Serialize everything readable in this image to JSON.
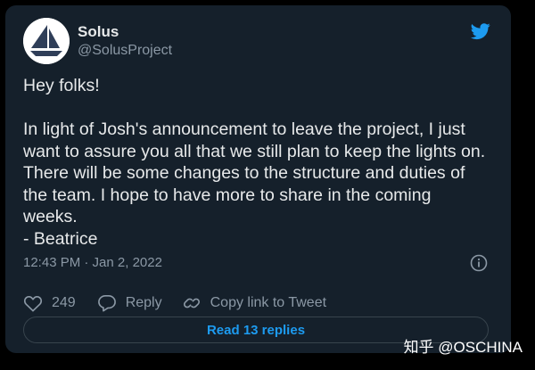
{
  "tweet": {
    "author_name": "Solus",
    "author_handle": "@SolusProject",
    "text": "Hey folks!\n\nIn light of Josh's announcement to leave the project, I just want to assure you all that we still plan to keep the lights on. There will be some changes to the structure and duties of the team. I hope to have more to share in the coming weeks.\n- Beatrice",
    "timestamp": "12:43 PM · Jan 2, 2022",
    "like_count": "249",
    "reply_label": "Reply",
    "copy_link_label": "Copy link to Tweet",
    "read_replies_label": "Read 13 replies"
  },
  "icons": {
    "brand": "twitter-bird-icon",
    "info": "info-icon",
    "like": "heart-icon",
    "reply": "speech-bubble-icon",
    "copy_link": "link-icon"
  },
  "watermark": "知乎 @OSCHINA",
  "colors": {
    "background": "#000000",
    "card": "#15202b",
    "primary_text": "#e7e9ea",
    "secondary_text": "#8b98a5",
    "accent": "#1d9bf0",
    "avatar_sail": "#2f3e58"
  }
}
